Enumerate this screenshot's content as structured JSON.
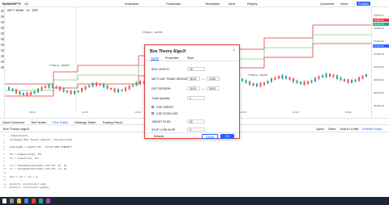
{
  "topbar": {
    "symbol": "BANKNIFTY",
    "interval": "1D",
    "indicators": "Indicators",
    "financials": "Financials",
    "templates": "Templates",
    "alert": "Alert",
    "replay": "Replay",
    "layout": "Unnamed",
    "save": "Save",
    "publish": "Publish"
  },
  "chart": {
    "title": "NIFTY BANK · 15 · NSE",
    "labels": [
      "TYPE (L) - ENTRY",
      "TYPE (L) - ENTRY",
      "TYPE (L) - ENTRY"
    ],
    "price_axis": [
      "37800.00",
      "37600.00",
      "37400.00",
      "37200.00",
      "37000.00",
      "36800.00",
      "36600.00",
      "36400.00"
    ],
    "time_axis": [
      "15:00",
      "14:00",
      "12:00",
      "10:00",
      "12:00",
      "14:00",
      "15:00"
    ],
    "tags": [
      {
        "text": "37580.60",
        "color": "#e53935"
      },
      {
        "text": "37497.55",
        "color": "#26a69a"
      },
      {
        "text": "37150.20",
        "color": "#2962ff"
      }
    ]
  },
  "bottom_tabs": [
    "Stock Screener",
    "Text Notes",
    "Pine Editor",
    "Strategy Tester",
    "Trading Panel"
  ],
  "editor": {
    "script_name": "Box Theory AlgoJI",
    "open": "Open",
    "save": "Save",
    "add_to_chart": "Add to Chart",
    "publish_script": "Publish Script",
    "lines": [
      "//@version=4",
      "strategy(\"Box Theory AlgoJI\", overlay=true)",
      "",
      "boxLength = input(\"15\", title=\"BOX LENGTH\")",
      "",
      "hh = highest(high, 15)",
      "ll = lowest(low, 15)",
      "",
      "rh = valuewhen(barstate.isfirst, hh, 0)",
      "rl = valuewhen(barstate.isfirst, ll, 0)",
      "",
      "mid = (rh + rl) / 2",
      "",
      "plot(rh, color=color.red)",
      "plot(rl, color=color.green)"
    ]
  },
  "dialog": {
    "title": "Box Theory AlgoJI",
    "tabs": [
      "Inputs",
      "Properties",
      "Style"
    ],
    "box_length_label": "BOX LENGTH",
    "box_length_value": "15",
    "nifty_session_label": "NIFTY-DAY TRADE SESSION",
    "nifty_from": "09:15",
    "nifty_to": "14:30",
    "exit_session_label": "EXIT SESSION",
    "exit_from": "15:15",
    "exit_to": "15:20",
    "trade_quantity_label": "Trade Quantity",
    "trade_quantity_value": "1",
    "use_target_label": "USE TARGET",
    "use_stoploss_label": "USE STOPLOSS",
    "target_label": "TARGET IN RS",
    "target_value": "50",
    "stoploss_label": "STOP LOSS IN RS",
    "stoploss_value": "0",
    "defaults": "Defaults",
    "cancel": "Cancel",
    "ok": "Ok"
  }
}
